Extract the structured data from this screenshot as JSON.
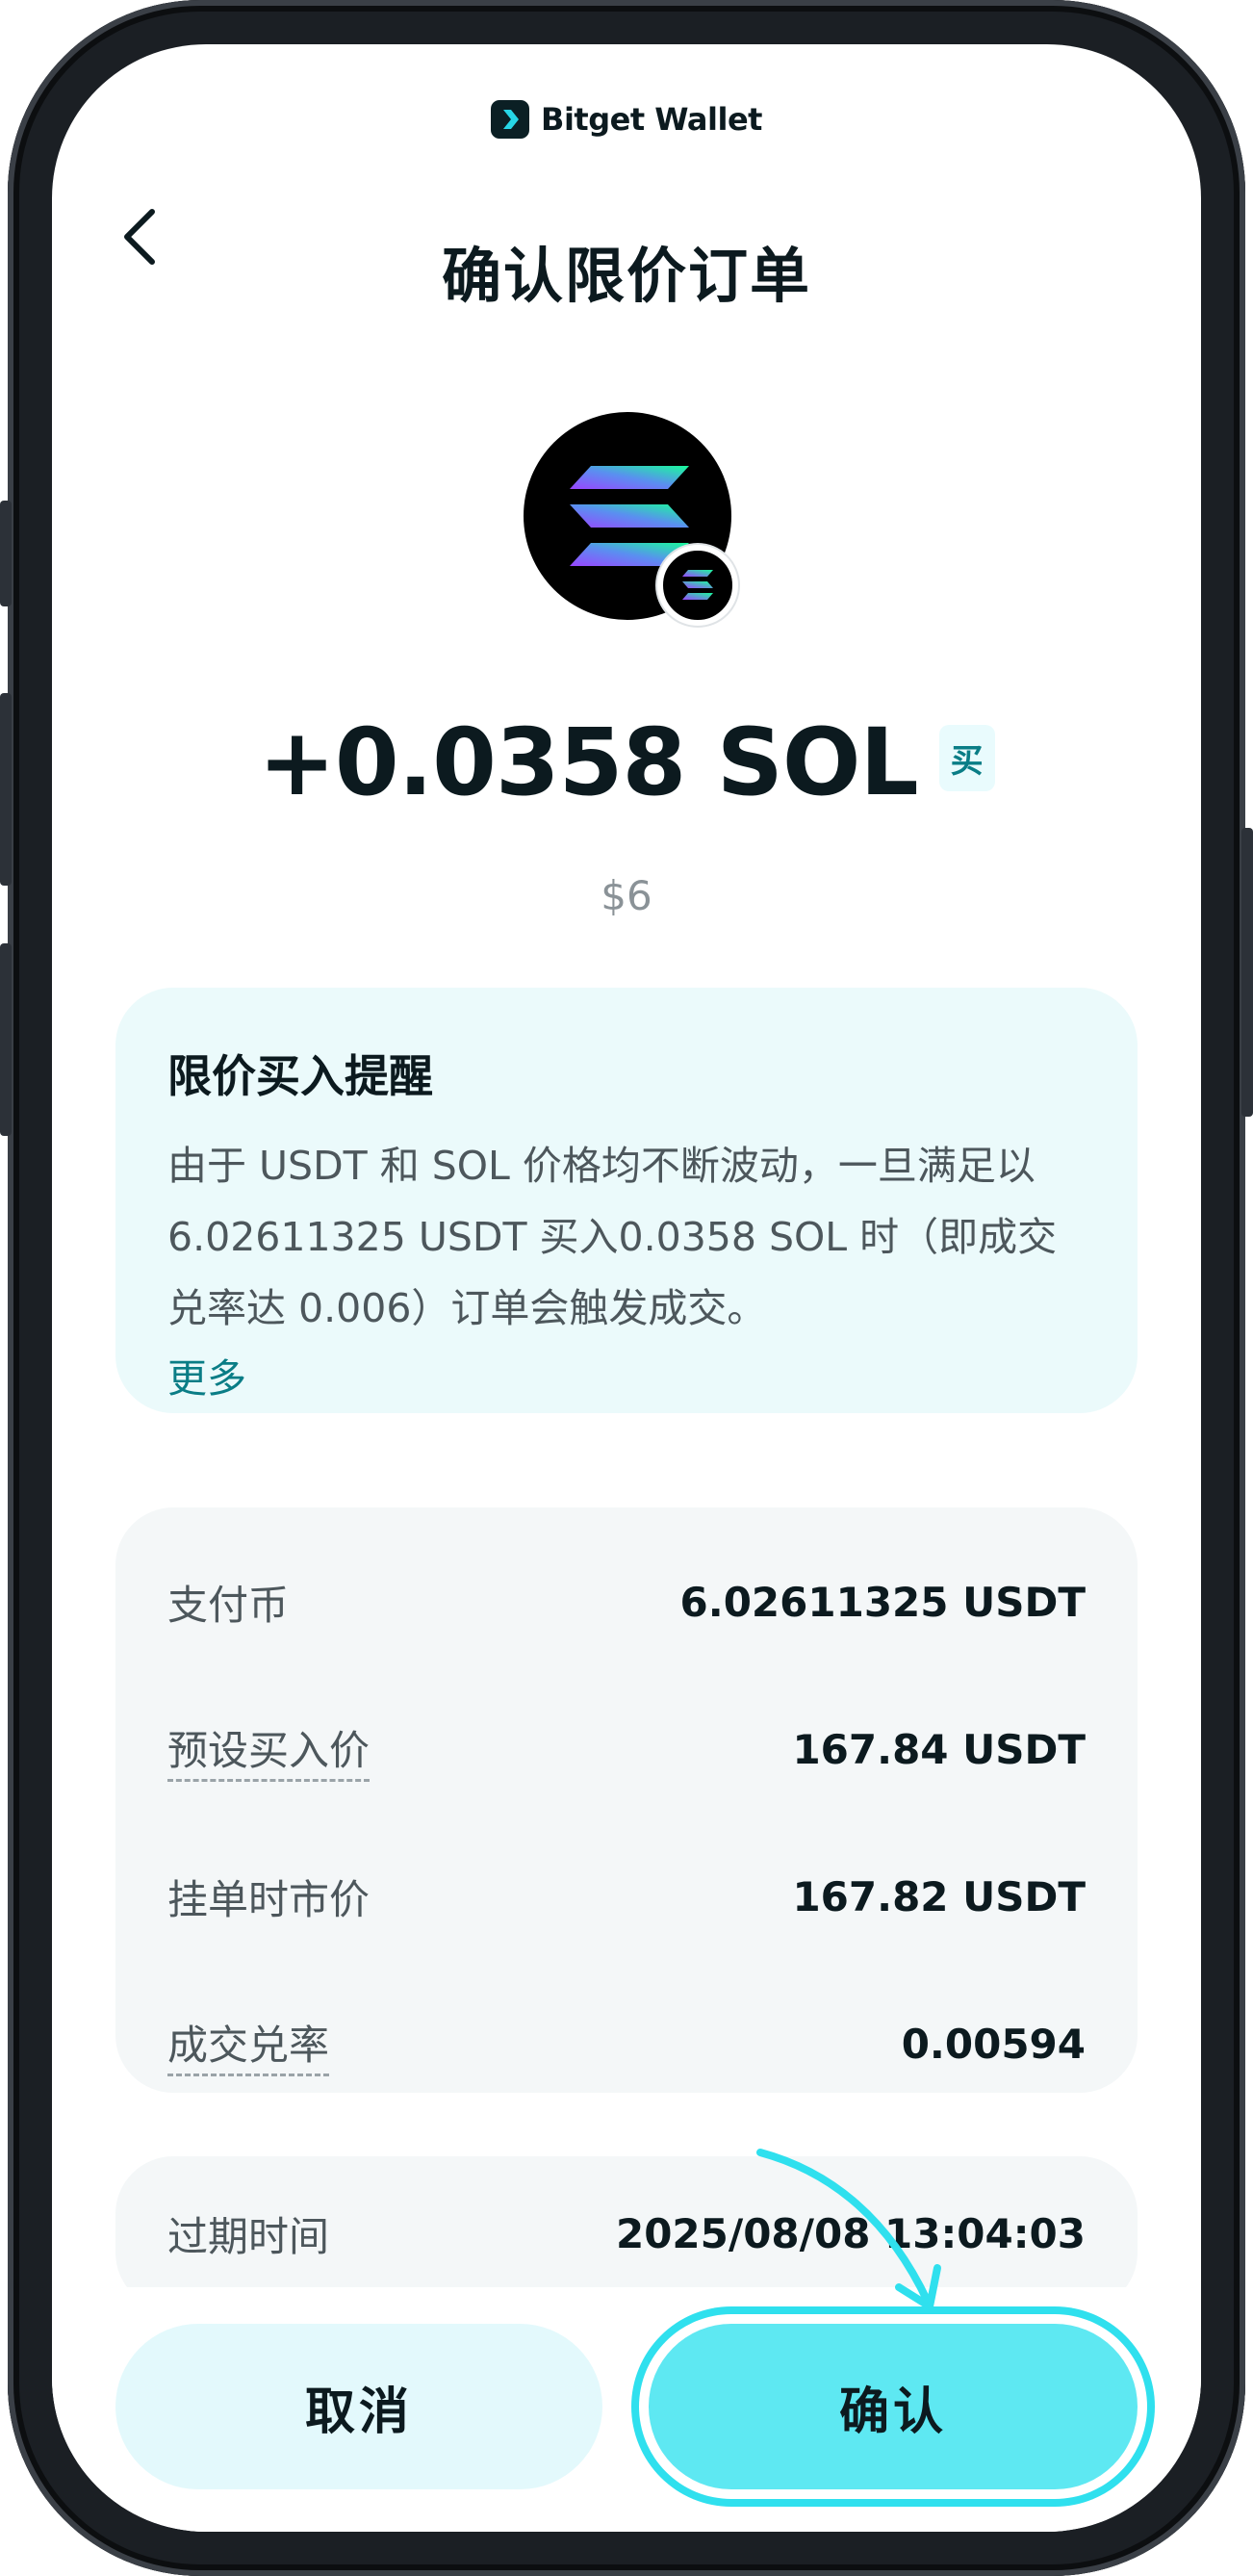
{
  "brand": {
    "name": "Bitget Wallet"
  },
  "header": {
    "title": "确认限价订单",
    "back_icon": "chevron-left-icon"
  },
  "token": {
    "symbol_icon": "solana-logo-icon",
    "chain_icon": "solana-chain-icon",
    "amount": "+0.0358 SOL",
    "side_badge": "买",
    "fiat_value": "$6"
  },
  "notice": {
    "title": "限价买入提醒",
    "body": "由于 USDT 和 SOL 价格均不断波动，一旦满足以 6.02611325 USDT 买入0.0358 SOL 时（即成交兑率达 0.006）订单会触发成交。",
    "more": "更多"
  },
  "details": [
    {
      "label": "支付币",
      "value": "6.02611325 USDT",
      "dashed": false
    },
    {
      "label": "预设买入价",
      "value": "167.84 USDT",
      "dashed": true
    },
    {
      "label": "挂单时市价",
      "value": "167.82 USDT",
      "dashed": false
    },
    {
      "label": "成交兑率",
      "value": "0.00594",
      "dashed": true
    }
  ],
  "expire": {
    "label": "过期时间",
    "value": "2025/08/08 13:04:03"
  },
  "actions": {
    "cancel": "取消",
    "confirm": "确认"
  },
  "colors": {
    "accent": "#5ee8f2",
    "accent_ring": "#2fe0ee",
    "link": "#0a7d86",
    "notice_bg": "#ebfafb",
    "card_bg": "#f4f7f8"
  }
}
